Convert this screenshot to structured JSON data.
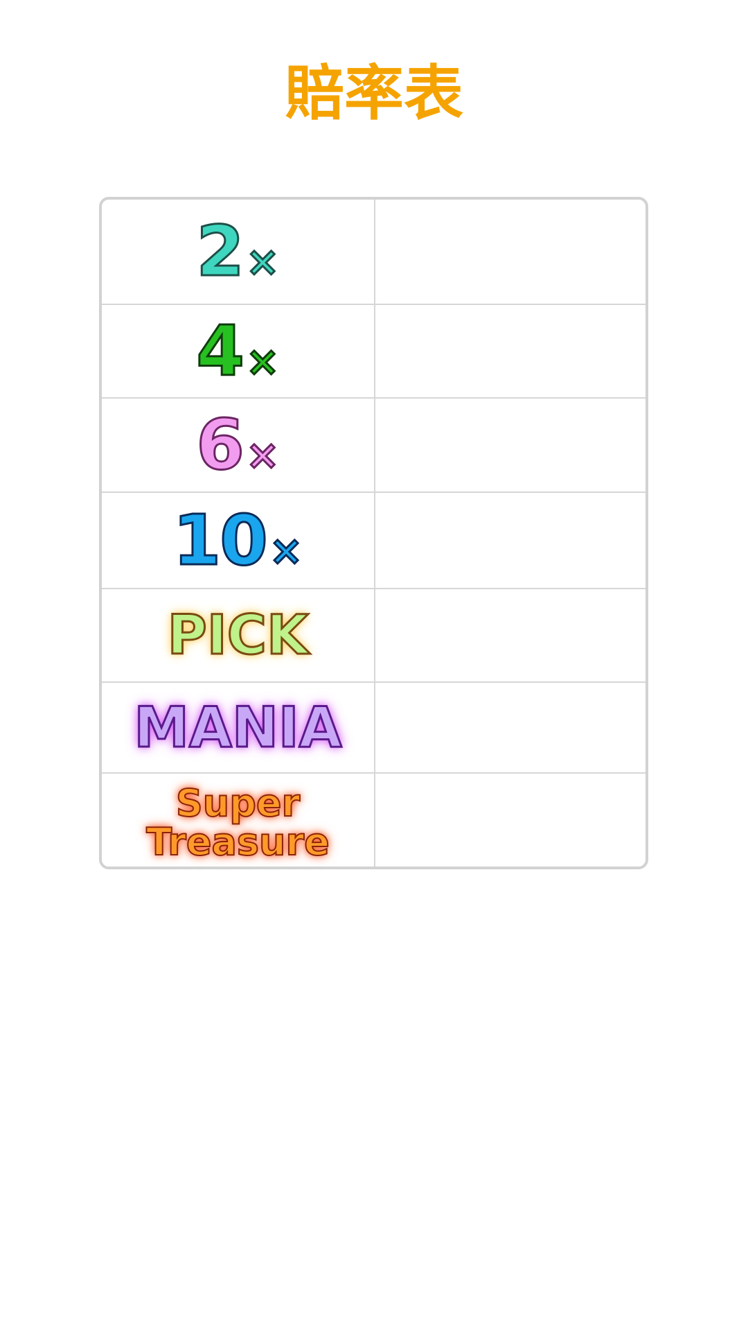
{
  "title": "賠率表",
  "symbols": [
    {
      "num": "2",
      "mult": "×"
    },
    {
      "num": "4",
      "mult": "×"
    },
    {
      "num": "6",
      "mult": "×"
    },
    {
      "num": "10",
      "mult": "×"
    }
  ],
  "words": {
    "pick": "PICK",
    "mania": "MANIA",
    "super_line1": "Super",
    "super_line2": "Treasure"
  },
  "colors": {
    "title": "#f5a300",
    "border": "#d2d2d2"
  }
}
